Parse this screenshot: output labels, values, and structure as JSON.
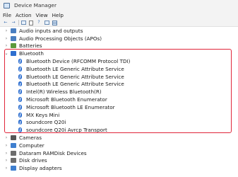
{
  "window": {
    "title": "Device Manager"
  },
  "menu": [
    "File",
    "Action",
    "View",
    "Help"
  ],
  "toolbar": {
    "buttons": [
      {
        "name": "back-arrow-icon",
        "glyph": "←"
      },
      {
        "name": "forward-arrow-icon",
        "glyph": "→"
      },
      {
        "name": "show-hide-icon",
        "glyph": ""
      },
      {
        "name": "properties-icon",
        "glyph": ""
      },
      {
        "name": "help-icon",
        "glyph": "?"
      },
      {
        "name": "update-driver-icon",
        "glyph": ""
      },
      {
        "name": "scan-hardware-icon",
        "glyph": ""
      }
    ]
  },
  "tree": {
    "categories_top": [
      {
        "label": "Audio inputs and outputs",
        "icon": "speaker-icon",
        "color": "#4a7fc1"
      },
      {
        "label": "Audio Processing Objects (APOs)",
        "icon": "speaker-icon",
        "color": "#4a7fc1"
      },
      {
        "label": "Batteries",
        "icon": "battery-icon",
        "color": "#5a9a3c"
      }
    ],
    "bluetooth": {
      "label": "Bluetooth",
      "devices": [
        "Bluetooth Device (RFCOMM Protocol TDI)",
        "Bluetooth LE Generic Attribute Service",
        "Bluetooth LE Generic Attribute Service",
        "Bluetooth LE Generic Attribute Service",
        "Intel(R) Wireless Bluetooth(R)",
        "Microsoft Bluetooth Enumerator",
        "Microsoft Bluetooth LE Enumerator",
        "MX Keys Mini",
        "soundcore Q20i",
        "soundcore Q20i Avrcp Transport"
      ]
    },
    "categories_bottom": [
      {
        "label": "Cameras",
        "icon": "camera-icon",
        "color": "#555555"
      },
      {
        "label": "Computer",
        "icon": "computer-icon",
        "color": "#3f7fcf"
      },
      {
        "label": "Dataram RAMDisk Devices",
        "icon": "disk-icon",
        "color": "#6d6d6d"
      },
      {
        "label": "Disk drives",
        "icon": "disk-icon",
        "color": "#6d6d6d"
      },
      {
        "label": "Display adapters",
        "icon": "monitor-icon",
        "color": "#3f7fcf"
      }
    ]
  },
  "colors": {
    "highlight": "#e0263a",
    "bluetooth": "#2e6fd0"
  }
}
